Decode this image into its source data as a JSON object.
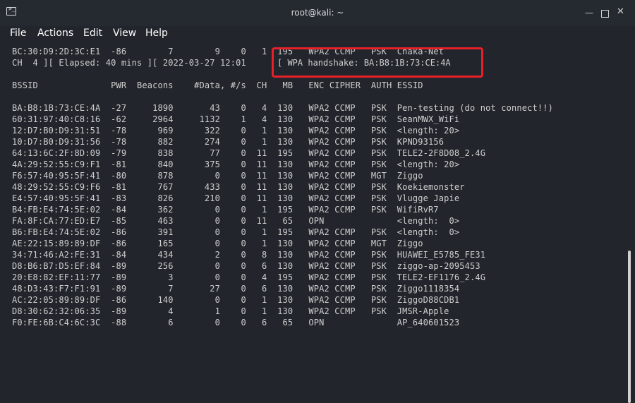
{
  "window": {
    "title": "root@kali: ~",
    "minimize_glyph": "—",
    "close_glyph": "✕"
  },
  "menu": [
    "File",
    "Actions",
    "Edit",
    "View",
    "Help"
  ],
  "terminal": {
    "status_lines": [
      "BC:30:D9:2D:3C:E1  -86        7        9    0   1  195   WPA2 CCMP   PSK  Chaka-Net",
      "CH  4 ][ Elapsed: 40 mins ][ 2022-03-27 12:01 "
    ],
    "handshake_text": "[ WPA handshake: BA:B8:1B:73:CE:4A",
    "header": "BSSID              PWR  Beacons    #Data, #/s  CH   MB   ENC CIPHER  AUTH ESSID",
    "rows": [
      "BA:B8:1B:73:CE:4A  -27     1890       43    0   4  130   WPA2 CCMP   PSK  Pen-testing (do not connect!!)",
      "60:31:97:40:C8:16  -62     2964     1132    1   4  130   WPA2 CCMP   PSK  SeanMWX_WiFi",
      "12:D7:B0:D9:31:51  -78      969      322    0   1  130   WPA2 CCMP   PSK  <length: 20>",
      "10:D7:B0:D9:31:56  -78      882      274    0   1  130   WPA2 CCMP   PSK  KPND93156",
      "64:13:6C:2F:8D:09  -79      838       77    0  11  195   WPA2 CCMP   PSK  TELE2-2F8D08_2.4G",
      "4A:29:52:55:C9:F1  -81      840      375    0  11  130   WPA2 CCMP   PSK  <length: 20>",
      "F6:57:40:95:5F:41  -80      878        0    0  11  130   WPA2 CCMP   MGT  Ziggo",
      "48:29:52:55:C9:F6  -81      767      433    0  11  130   WPA2 CCMP   PSK  Koekiemonster",
      "E4:57:40:95:5F:41  -83      826      210    0  11  130   WPA2 CCMP   PSK  Vlugge Japie",
      "B4:FB:E4:74:5E:02  -84      362        0    0   1  195   WPA2 CCMP   PSK  WifiRvR7",
      "FA:8F:CA:77:ED:E7  -85      463        0    0  11   65   OPN              <length:  0>",
      "B6:FB:E4:74:5E:02  -86      391        0    0   1  195   WPA2 CCMP   PSK  <length:  0>",
      "AE:22:15:89:89:DF  -86      165        0    0   1  130   WPA2 CCMP   MGT  Ziggo",
      "34:71:46:A2:FE:31  -84      434        2    0   8  130   WPA2 CCMP   PSK  HUAWEI_E5785_FE31",
      "D8:B6:B7:D5:EF:84  -89      256        0    0   6  130   WPA2 CCMP   PSK  ziggo-ap-2095453",
      "20:E8:82:EF:11:77  -89        3        0    0   4  195   WPA2 CCMP   PSK  TELE2-EF1176_2.4G",
      "48:D3:43:F7:F1:91  -89        7       27    0   6  130   WPA2 CCMP   PSK  Ziggo1118354",
      "AC:22:05:89:89:DF  -86      140        0    0   1  130   WPA2 CCMP   PSK  ZiggoD88CDB1",
      "D8:30:62:32:06:35  -89        4        1    0   1  130   WPA2 CCMP   PSK  JMSR-Apple",
      "F0:FE:6B:C4:6C:3C  -88        6        0    0   6   65   OPN              AP_640601523"
    ]
  },
  "highlight_color": "#e8202a"
}
